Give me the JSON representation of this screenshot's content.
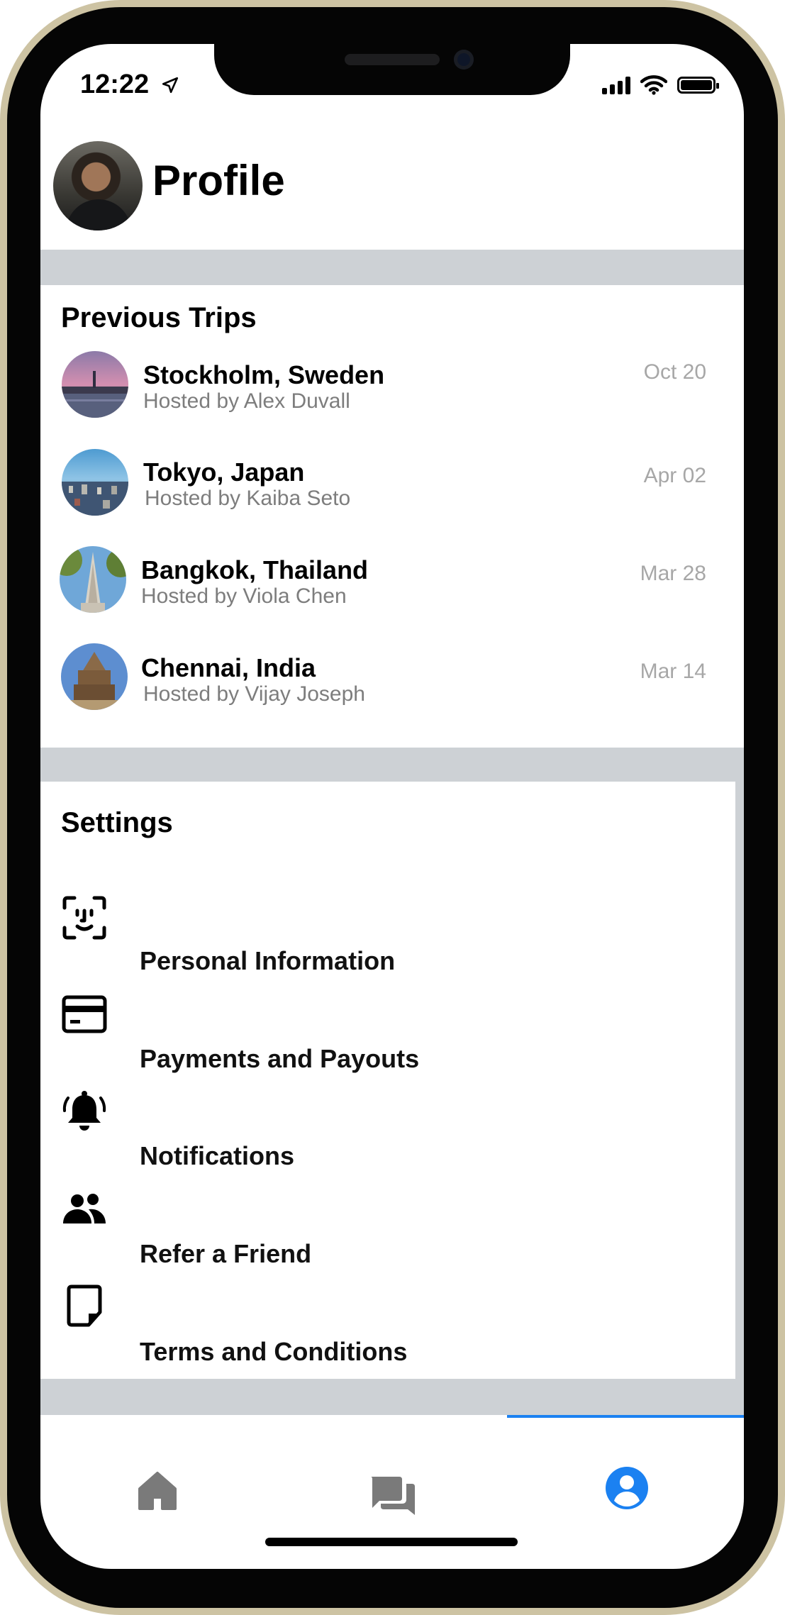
{
  "status_bar": {
    "time": "12:22"
  },
  "header": {
    "title": "Profile",
    "avatar_icon": "user-photo"
  },
  "previous_trips": {
    "title": "Previous Trips",
    "items": [
      {
        "name": "Stockholm, Sweden",
        "host": "Hosted by Alex Duvall",
        "date": "Oct 20"
      },
      {
        "name": "Tokyo, Japan",
        "host": "Hosted by Kaiba Seto",
        "date": "Apr 02"
      },
      {
        "name": "Bangkok, Thailand",
        "host": "Hosted by Viola Chen",
        "date": "Mar 28"
      },
      {
        "name": "Chennai, India",
        "host": "Hosted by Vijay Joseph",
        "date": "Mar 14"
      }
    ]
  },
  "settings": {
    "title": "Settings",
    "items": [
      {
        "label": "Personal Information",
        "icon": "face-id-icon"
      },
      {
        "label": "Payments and Payouts",
        "icon": "credit-card-icon"
      },
      {
        "label": "Notifications",
        "icon": "bell-icon"
      },
      {
        "label": "Refer a Friend",
        "icon": "people-icon"
      },
      {
        "label": "Terms and Conditions",
        "icon": "document-icon"
      }
    ]
  },
  "tab_bar": {
    "tabs": [
      {
        "icon": "home-icon",
        "active": false
      },
      {
        "icon": "chat-icon",
        "active": false
      },
      {
        "icon": "profile-icon",
        "active": true
      }
    ],
    "active_color": "#1b81f1",
    "inactive_color": "#7a7a7a"
  },
  "colors": {
    "divider": "#cdd1d5",
    "secondary_text": "#7d7d7d",
    "date_text": "#a7a7a7"
  }
}
